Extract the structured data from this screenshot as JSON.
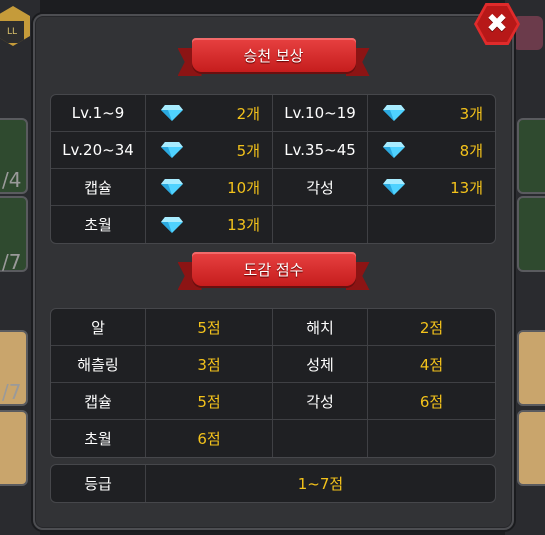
{
  "background": {
    "left_counts": [
      "/4",
      "/7",
      "/7"
    ]
  },
  "title_reward": "승천 보상",
  "title_score": "도감 점수",
  "rewards": [
    [
      {
        "label": "Lv.1~9",
        "value": "2개"
      },
      {
        "label": "Lv.10~19",
        "value": "3개"
      }
    ],
    [
      {
        "label": "Lv.20~34",
        "value": "5개"
      },
      {
        "label": "Lv.35~45",
        "value": "8개"
      }
    ],
    [
      {
        "label": "캡슐",
        "value": "10개"
      },
      {
        "label": "각성",
        "value": "13개"
      }
    ],
    [
      {
        "label": "초월",
        "value": "13개"
      },
      {
        "label": "",
        "value": ""
      }
    ]
  ],
  "scores": [
    [
      {
        "label": "알",
        "value": "5점"
      },
      {
        "label": "해치",
        "value": "2점"
      }
    ],
    [
      {
        "label": "해츨링",
        "value": "3점"
      },
      {
        "label": "성체",
        "value": "4점"
      }
    ],
    [
      {
        "label": "캡슐",
        "value": "5점"
      },
      {
        "label": "각성",
        "value": "6점"
      }
    ],
    [
      {
        "label": "초월",
        "value": "6점"
      },
      {
        "label": "",
        "value": ""
      }
    ]
  ],
  "grade": {
    "label": "등급",
    "value": "1~7점"
  },
  "close_icon": "close-icon",
  "gem_icon": "diamond-icon",
  "colors": {
    "value": "#f3c21b",
    "ribbon": "#d42828",
    "close": "#e02b2b"
  }
}
